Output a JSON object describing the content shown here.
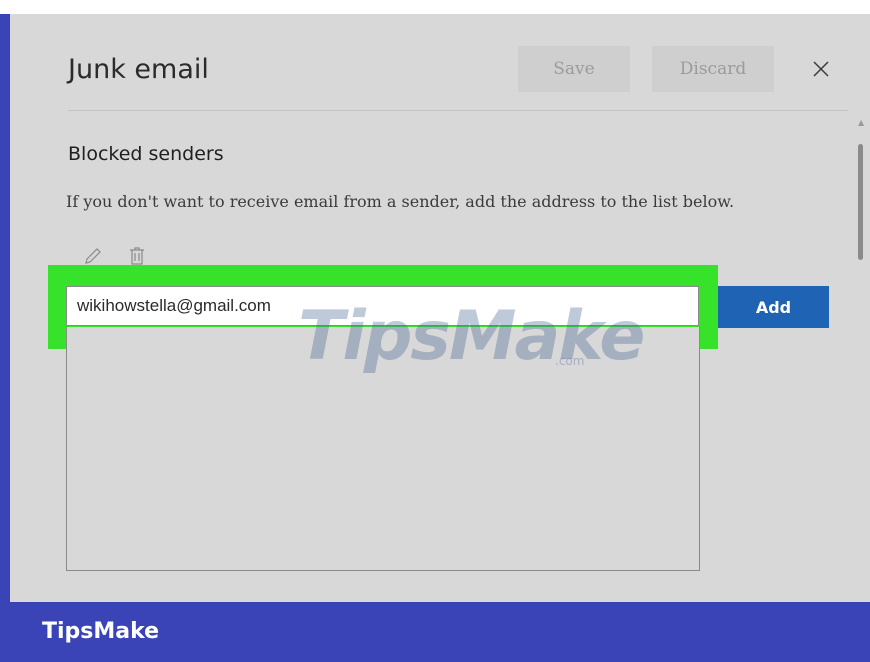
{
  "dialog": {
    "title": "Junk email",
    "save_label": "Save",
    "discard_label": "Discard"
  },
  "blocked": {
    "section_title": "Blocked senders",
    "description": "If you don't want to receive email from a sender, add the address to the list below.",
    "input_value": "wikihowstella@gmail.com",
    "add_label": "Add"
  },
  "icons": {
    "close": "close-icon",
    "edit": "pencil-icon",
    "delete": "trash-icon"
  },
  "watermark": {
    "text": "TipsMake",
    "suffix": ".com"
  },
  "footer": {
    "brand": "TipsMake"
  },
  "colors": {
    "highlight": "#37e22b",
    "add_button": "#1e63b4",
    "banner": "#3a44b6"
  }
}
